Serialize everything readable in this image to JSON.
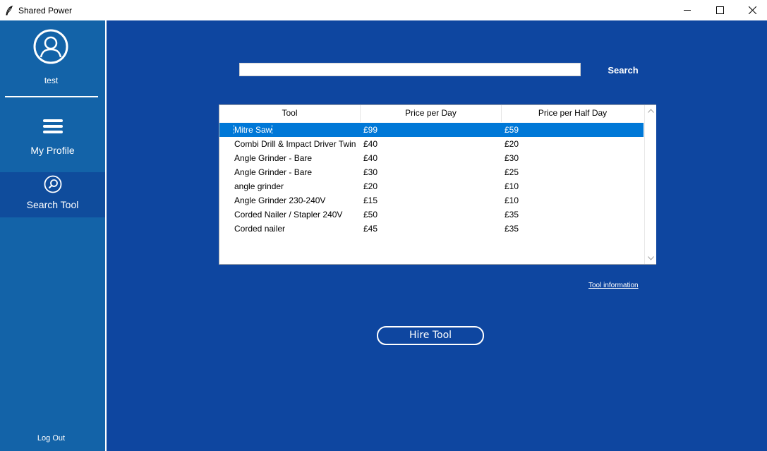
{
  "window": {
    "title": "Shared Power",
    "icon": "feather-icon",
    "controls": [
      "minimize-icon",
      "maximize-icon",
      "close-icon"
    ]
  },
  "sidebar": {
    "username": "test",
    "nav": [
      {
        "label": "My Profile",
        "icon": "menu-icon",
        "active": false
      },
      {
        "label": "Search Tool",
        "icon": "search-icon",
        "active": true
      }
    ],
    "logout_label": "Log Out"
  },
  "search": {
    "value": "",
    "placeholder": "",
    "button_label": "Search"
  },
  "table": {
    "columns": [
      "Tool",
      "Price per Day",
      "Price per Half Day"
    ],
    "selected_row": 0,
    "rows": [
      [
        "Mitre Saw",
        "£99",
        "£59"
      ],
      [
        "Combi Drill & Impact Driver Twin",
        "£40",
        "£20"
      ],
      [
        "Angle Grinder - Bare",
        "£40",
        "£30"
      ],
      [
        "Angle Grinder - Bare",
        "£30",
        "£25"
      ],
      [
        "angle grinder",
        "£20",
        "£10"
      ],
      [
        "Angle Grinder 230-240V",
        "£15",
        "£10"
      ],
      [
        "Corded Nailer / Stapler 240V",
        "£50",
        "£35"
      ],
      [
        "Corded nailer",
        "£45",
        "£35"
      ]
    ]
  },
  "links": {
    "tool_info": "Tool information"
  },
  "actions": {
    "hire_label": "Hire Tool"
  },
  "colors": {
    "sidebar_bg": "#1363a8",
    "sidebar_active": "#0f4c9c",
    "main_bg": "#0e46a0",
    "selection": "#0078d7"
  }
}
